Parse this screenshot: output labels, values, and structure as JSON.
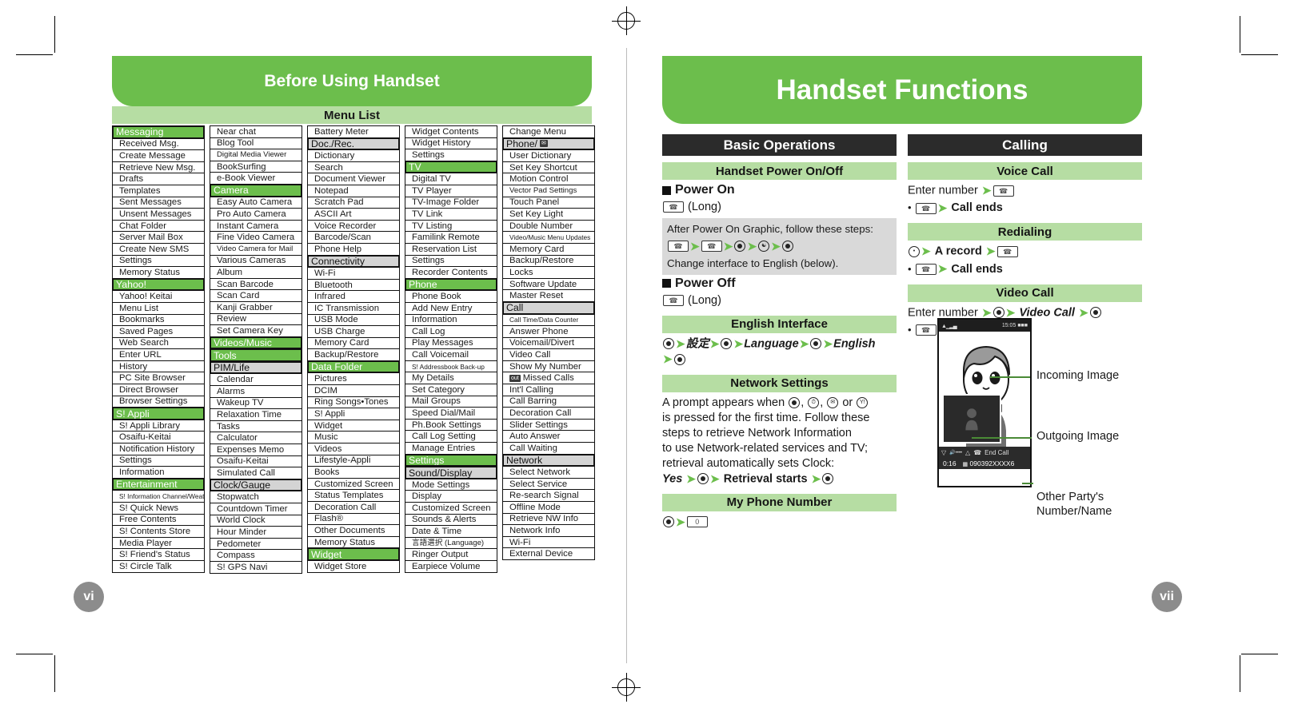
{
  "left_page": {
    "banner_title": "Before Using Handset",
    "section_title": "Menu List",
    "page_number": "vi",
    "menu_columns": [
      [
        {
          "t": "Messaging",
          "lvl": 1
        },
        {
          "t": "Received Msg.",
          "lvl": 3
        },
        {
          "t": "Create Message",
          "lvl": 3
        },
        {
          "t": "Retrieve New Msg.",
          "lvl": 3
        },
        {
          "t": "Drafts",
          "lvl": 3
        },
        {
          "t": "Templates",
          "lvl": 3
        },
        {
          "t": "Sent Messages",
          "lvl": 3
        },
        {
          "t": "Unsent Messages",
          "lvl": 3
        },
        {
          "t": "Chat Folder",
          "lvl": 3
        },
        {
          "t": "Server Mail Box",
          "lvl": 3
        },
        {
          "t": "Create New SMS",
          "lvl": 3
        },
        {
          "t": "Settings",
          "lvl": 3
        },
        {
          "t": "Memory Status",
          "lvl": 3
        },
        {
          "t": "Yahoo!",
          "lvl": 1
        },
        {
          "t": "Yahoo! Keitai",
          "lvl": 3
        },
        {
          "t": "Menu List",
          "lvl": 3
        },
        {
          "t": "Bookmarks",
          "lvl": 3
        },
        {
          "t": "Saved Pages",
          "lvl": 3
        },
        {
          "t": "Web Search",
          "lvl": 3
        },
        {
          "t": "Enter URL",
          "lvl": 3
        },
        {
          "t": "History",
          "lvl": 3
        },
        {
          "t": "PC Site Browser",
          "lvl": 3
        },
        {
          "t": "Direct Browser",
          "lvl": 3
        },
        {
          "t": "Browser Settings",
          "lvl": 3
        },
        {
          "t": "S! Appli",
          "lvl": 1
        },
        {
          "t": "S! Appli Library",
          "lvl": 3
        },
        {
          "t": "Osaifu-Keitai",
          "lvl": 3
        },
        {
          "t": "Notification History",
          "lvl": 3
        },
        {
          "t": "Settings",
          "lvl": 3
        },
        {
          "t": "Information",
          "lvl": 3
        },
        {
          "t": "Entertainment",
          "lvl": 1
        },
        {
          "t": "S! Information Channel/Weather",
          "lvl": 3,
          "size": "tiny"
        },
        {
          "t": "S! Quick News",
          "lvl": 3
        },
        {
          "t": "Free Contents",
          "lvl": 3
        },
        {
          "t": "S! Contents Store",
          "lvl": 3
        },
        {
          "t": "Media Player",
          "lvl": 3
        },
        {
          "t": "S! Friend's Status",
          "lvl": 3
        },
        {
          "t": "S! Circle Talk",
          "lvl": 3
        }
      ],
      [
        {
          "t": "Near chat",
          "lvl": 3
        },
        {
          "t": "Blog Tool",
          "lvl": 3
        },
        {
          "t": "Digital Media Viewer",
          "lvl": 3,
          "size": "small"
        },
        {
          "t": "BookSurfing",
          "lvl": 3
        },
        {
          "t": "e-Book Viewer",
          "lvl": 3
        },
        {
          "t": "Camera",
          "lvl": 1
        },
        {
          "t": "Easy Auto Camera",
          "lvl": 3
        },
        {
          "t": "Pro Auto Camera",
          "lvl": 3
        },
        {
          "t": "Instant Camera",
          "lvl": 3
        },
        {
          "t": "Fine Video Camera",
          "lvl": 3
        },
        {
          "t": "Video Camera for Mail",
          "lvl": 3,
          "size": "small"
        },
        {
          "t": "Various Cameras",
          "lvl": 3
        },
        {
          "t": "Album",
          "lvl": 3
        },
        {
          "t": "Scan Barcode",
          "lvl": 3
        },
        {
          "t": "Scan Card",
          "lvl": 3
        },
        {
          "t": "Kanji Grabber",
          "lvl": 3
        },
        {
          "t": "Review",
          "lvl": 3
        },
        {
          "t": "Set Camera Key",
          "lvl": 3
        },
        {
          "t": "Videos/Music",
          "lvl": 1
        },
        {
          "t": "Tools",
          "lvl": 1
        },
        {
          "t": "PIM/Life",
          "lvl": 2
        },
        {
          "t": "Calendar",
          "lvl": 3
        },
        {
          "t": "Alarms",
          "lvl": 3
        },
        {
          "t": "Wakeup TV",
          "lvl": 3
        },
        {
          "t": "Relaxation Time",
          "lvl": 3
        },
        {
          "t": "Tasks",
          "lvl": 3
        },
        {
          "t": "Calculator",
          "lvl": 3
        },
        {
          "t": "Expenses Memo",
          "lvl": 3
        },
        {
          "t": "Osaifu-Keitai",
          "lvl": 3
        },
        {
          "t": "Simulated Call",
          "lvl": 3
        },
        {
          "t": "Clock/Gauge",
          "lvl": 2
        },
        {
          "t": "Stopwatch",
          "lvl": 3
        },
        {
          "t": "Countdown Timer",
          "lvl": 3
        },
        {
          "t": "World Clock",
          "lvl": 3
        },
        {
          "t": "Hour Minder",
          "lvl": 3
        },
        {
          "t": "Pedometer",
          "lvl": 3
        },
        {
          "t": "Compass",
          "lvl": 3
        },
        {
          "t": "S! GPS Navi",
          "lvl": 3
        }
      ],
      [
        {
          "t": "Battery Meter",
          "lvl": 3
        },
        {
          "t": "Doc./Rec.",
          "lvl": 2
        },
        {
          "t": "Dictionary",
          "lvl": 3
        },
        {
          "t": "Search",
          "lvl": 3
        },
        {
          "t": "Document Viewer",
          "lvl": 3
        },
        {
          "t": "Notepad",
          "lvl": 3
        },
        {
          "t": "Scratch Pad",
          "lvl": 3
        },
        {
          "t": "ASCII Art",
          "lvl": 3
        },
        {
          "t": "Voice Recorder",
          "lvl": 3
        },
        {
          "t": "Barcode/Scan",
          "lvl": 3
        },
        {
          "t": "Phone Help",
          "lvl": 3
        },
        {
          "t": "Connectivity",
          "lvl": 2
        },
        {
          "t": "Wi-Fi",
          "lvl": 3
        },
        {
          "t": "Bluetooth",
          "lvl": 3
        },
        {
          "t": "Infrared",
          "lvl": 3
        },
        {
          "t": "IC Transmission",
          "lvl": 3
        },
        {
          "t": "USB Mode",
          "lvl": 3
        },
        {
          "t": "USB Charge",
          "lvl": 3
        },
        {
          "t": "Memory Card",
          "lvl": 3
        },
        {
          "t": "Backup/Restore",
          "lvl": 3
        },
        {
          "t": "Data Folder",
          "lvl": 1
        },
        {
          "t": "Pictures",
          "lvl": 3
        },
        {
          "t": "DCIM",
          "lvl": 3
        },
        {
          "t": "Ring Songs•Tones",
          "lvl": 3
        },
        {
          "t": "S! Appli",
          "lvl": 3
        },
        {
          "t": "Widget",
          "lvl": 3
        },
        {
          "t": "Music",
          "lvl": 3
        },
        {
          "t": "Videos",
          "lvl": 3
        },
        {
          "t": "Lifestyle-Appli",
          "lvl": 3
        },
        {
          "t": "Books",
          "lvl": 3
        },
        {
          "t": "Customized Screen",
          "lvl": 3
        },
        {
          "t": "Status Templates",
          "lvl": 3
        },
        {
          "t": "Decoration Call",
          "lvl": 3
        },
        {
          "t": "Flash®",
          "lvl": 3
        },
        {
          "t": "Other Documents",
          "lvl": 3
        },
        {
          "t": "Memory Status",
          "lvl": 3
        },
        {
          "t": "Widget",
          "lvl": 1
        },
        {
          "t": "Widget Store",
          "lvl": 3
        }
      ],
      [
        {
          "t": "Widget Contents",
          "lvl": 3
        },
        {
          "t": "Widget History",
          "lvl": 3
        },
        {
          "t": "Settings",
          "lvl": 3
        },
        {
          "t": "TV",
          "lvl": 1
        },
        {
          "t": "Digital TV",
          "lvl": 3
        },
        {
          "t": "TV Player",
          "lvl": 3
        },
        {
          "t": "TV-Image Folder",
          "lvl": 3
        },
        {
          "t": "TV Link",
          "lvl": 3
        },
        {
          "t": "TV Listing",
          "lvl": 3
        },
        {
          "t": "Familink Remote",
          "lvl": 3
        },
        {
          "t": "Reservation List",
          "lvl": 3
        },
        {
          "t": "Settings",
          "lvl": 3
        },
        {
          "t": "Recorder Contents",
          "lvl": 3
        },
        {
          "t": "Phone",
          "lvl": 1
        },
        {
          "t": "Phone Book",
          "lvl": 3
        },
        {
          "t": "Add New Entry",
          "lvl": 3
        },
        {
          "t": "Information",
          "lvl": 3
        },
        {
          "t": "Call Log",
          "lvl": 3
        },
        {
          "t": "Play Messages",
          "lvl": 3
        },
        {
          "t": "Call Voicemail",
          "lvl": 3
        },
        {
          "t": "S! Addressbook Back-up",
          "lvl": 3,
          "size": "tiny"
        },
        {
          "t": "My Details",
          "lvl": 3
        },
        {
          "t": "Set Category",
          "lvl": 3
        },
        {
          "t": "Mail Groups",
          "lvl": 3
        },
        {
          "t": "Speed Dial/Mail",
          "lvl": 3
        },
        {
          "t": "Ph.Book Settings",
          "lvl": 3
        },
        {
          "t": "Call Log Setting",
          "lvl": 3
        },
        {
          "t": "Manage Entries",
          "lvl": 3
        },
        {
          "t": "Settings",
          "lvl": 1
        },
        {
          "t": "Sound/Display",
          "lvl": 2
        },
        {
          "t": "Mode Settings",
          "lvl": 3
        },
        {
          "t": "Display",
          "lvl": 3
        },
        {
          "t": "Customized Screen",
          "lvl": 3
        },
        {
          "t": "Sounds & Alerts",
          "lvl": 3
        },
        {
          "t": "Date & Time",
          "lvl": 3
        },
        {
          "t": "言語選択 (Language)",
          "lvl": 3,
          "size": "small"
        },
        {
          "t": "Ringer Output",
          "lvl": 3
        },
        {
          "t": "Earpiece Volume",
          "lvl": 3
        }
      ],
      [
        {
          "t": "Change Menu",
          "lvl": 3
        },
        {
          "t": "Phone/",
          "lvl": 2,
          "icon": "mail-icon"
        },
        {
          "t": "User Dictionary",
          "lvl": 3
        },
        {
          "t": "Set Key Shortcut",
          "lvl": 3
        },
        {
          "t": "Motion Control",
          "lvl": 3
        },
        {
          "t": "Vector Pad Settings",
          "lvl": 3,
          "size": "small"
        },
        {
          "t": "Touch Panel",
          "lvl": 3
        },
        {
          "t": "Set Key Light",
          "lvl": 3
        },
        {
          "t": "Double Number",
          "lvl": 3
        },
        {
          "t": "Video/Music Menu Updates",
          "lvl": 3,
          "size": "tiny"
        },
        {
          "t": "Memory Card",
          "lvl": 3
        },
        {
          "t": "Backup/Restore",
          "lvl": 3
        },
        {
          "t": "Locks",
          "lvl": 3
        },
        {
          "t": "Software Update",
          "lvl": 3
        },
        {
          "t": "Master Reset",
          "lvl": 3
        },
        {
          "t": "Call",
          "lvl": 2
        },
        {
          "t": "Call Time/Data Counter",
          "lvl": 3,
          "size": "tiny"
        },
        {
          "t": "Answer Phone",
          "lvl": 3
        },
        {
          "t": "Voicemail/Divert",
          "lvl": 3
        },
        {
          "t": "Video Call",
          "lvl": 3
        },
        {
          "t": "Show My Number",
          "lvl": 3
        },
        {
          "t": "Missed Calls",
          "lvl": 3,
          "badge": "out"
        },
        {
          "t": "Int'l Calling",
          "lvl": 3
        },
        {
          "t": "Call Barring",
          "lvl": 3
        },
        {
          "t": "Decoration Call",
          "lvl": 3
        },
        {
          "t": "Slider Settings",
          "lvl": 3
        },
        {
          "t": "Auto Answer",
          "lvl": 3
        },
        {
          "t": "Call Waiting",
          "lvl": 3
        },
        {
          "t": "Network",
          "lvl": 2
        },
        {
          "t": "Select Network",
          "lvl": 3
        },
        {
          "t": "Select Service",
          "lvl": 3
        },
        {
          "t": "Re-search Signal",
          "lvl": 3
        },
        {
          "t": "Offline Mode",
          "lvl": 3
        },
        {
          "t": "Retrieve NW Info",
          "lvl": 3
        },
        {
          "t": "Network Info",
          "lvl": 3
        },
        {
          "t": "Wi-Fi",
          "lvl": 3
        },
        {
          "t": "External Device",
          "lvl": 3
        }
      ]
    ]
  },
  "right_page": {
    "banner_title": "Handset Functions",
    "page_number": "vii",
    "basic_operations": {
      "heading": "Basic Operations",
      "power_section": {
        "sub_heading": "Handset Power On/Off",
        "power_on_label": "Power On",
        "power_on_key_note": "(Long)",
        "grey_note_line1": "After Power On Graphic, follow these steps:",
        "grey_note_line2": "Change interface to English (below).",
        "power_off_label": "Power Off",
        "power_off_key_note": "(Long)"
      },
      "english_interface": {
        "sub_heading": "English Interface",
        "step_japanese": "設定",
        "step_language": "Language",
        "step_english": "English"
      },
      "network_settings": {
        "sub_heading": "Network Settings",
        "para_1": "A prompt appears when",
        "para_2": "is pressed for the first time. Follow these",
        "para_3": "steps to retrieve Network Information",
        "para_4": "to use Network-related services and TV;",
        "para_5": "retrieval automatically sets Clock:",
        "confirm_yes": "Yes",
        "confirm_result": "Retrieval starts"
      },
      "my_phone_number": {
        "sub_heading": "My Phone Number",
        "key_label": "0"
      }
    },
    "calling": {
      "heading": "Calling",
      "voice_call": {
        "sub_heading": "Voice Call",
        "line_1": "Enter number",
        "line_2": "Call ends"
      },
      "redialing": {
        "sub_heading": "Redialing",
        "line_1": "A record",
        "line_2": "Call ends"
      },
      "video_call": {
        "sub_heading": "Video Call",
        "line_1": "Enter number",
        "line_1_item": "Video Call",
        "line_2": "Call ends"
      },
      "callouts": [
        "Incoming Image",
        "Outgoing Image",
        "Other Party's\nNumber/Name"
      ],
      "phone_screen": {
        "status_time": "15:05",
        "softkey_label": "End Call",
        "call_duration": "0:16",
        "other_party_number": "090392XXXX6"
      }
    }
  },
  "colors": {
    "brand_green": "#6cbe4c",
    "light_green": "#b6dda3",
    "dark_header": "#2b2b2b",
    "grey_box": "#d9d9d9",
    "grey_subhead": "#d4d4d4"
  }
}
